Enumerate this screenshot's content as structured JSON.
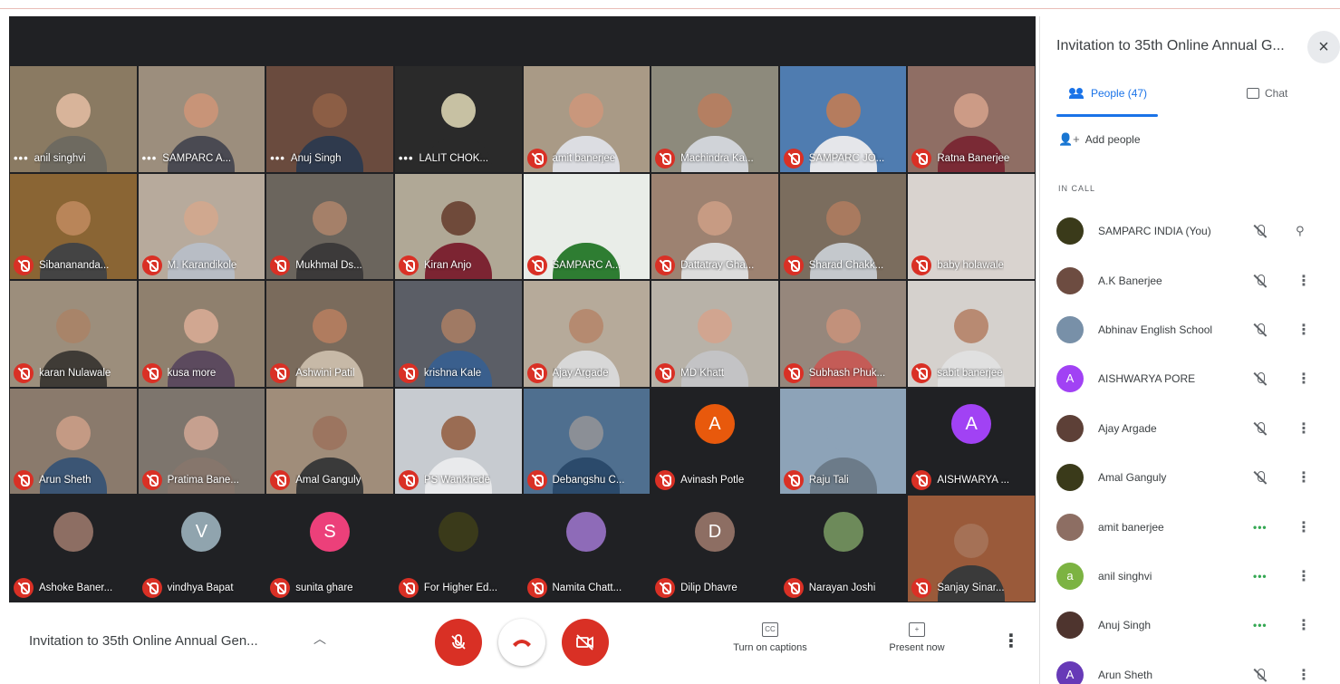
{
  "meeting": {
    "title": "Invitation to 35th Online Annual Gen..."
  },
  "controls": {
    "captions_label": "Turn on captions",
    "present_label": "Present now",
    "expand_icon": "chevron-up-icon",
    "colors": {
      "danger": "#d93025",
      "accent": "#1a73e8"
    }
  },
  "panel": {
    "title": "Invitation to 35th Online Annual G...",
    "tabs": {
      "people": "People (47)",
      "chat": "Chat"
    },
    "add_people": "Add people",
    "section_label": "IN CALL",
    "participants": [
      {
        "name": "SAMPARC INDIA (You)",
        "initial": "",
        "color": "#3a3a1a",
        "status": "muted",
        "action": "pin"
      },
      {
        "name": "A.K Banerjee",
        "initial": "",
        "color": "#6d4c41",
        "status": "muted",
        "action": "more"
      },
      {
        "name": "Abhinav English School",
        "initial": "",
        "color": "#7890a8",
        "status": "muted",
        "action": "more"
      },
      {
        "name": "AISHWARYA PORE",
        "initial": "A",
        "color": "#a142f4",
        "status": "muted",
        "action": "more"
      },
      {
        "name": "Ajay Argade",
        "initial": "",
        "color": "#5d4037",
        "status": "muted",
        "action": "more"
      },
      {
        "name": "Amal Ganguly",
        "initial": "",
        "color": "#3a3a1a",
        "status": "muted",
        "action": "more"
      },
      {
        "name": "amit banerjee",
        "initial": "",
        "color": "#8d6e63",
        "status": "speaking",
        "action": "more"
      },
      {
        "name": "anil singhvi",
        "initial": "a",
        "color": "#7cb342",
        "status": "speaking",
        "action": "more"
      },
      {
        "name": "Anuj Singh",
        "initial": "",
        "color": "#4e342e",
        "status": "speaking",
        "action": "more"
      },
      {
        "name": "Arun Sheth",
        "initial": "A",
        "color": "#673ab7",
        "status": "muted",
        "action": "more"
      }
    ]
  },
  "tiles": [
    {
      "name": "anil singhvi",
      "indicator": "dots",
      "bg": "#8a7a62",
      "skin": "#d8b49a",
      "shirt": "#6e6a60"
    },
    {
      "name": "SAMPARC A...",
      "indicator": "dots",
      "bg": "#9c8e7d",
      "skin": "#c89478",
      "shirt": "#4a4a52"
    },
    {
      "name": "Anuj Singh",
      "indicator": "dots",
      "bg": "#6a4b3e",
      "skin": "#8c5e45",
      "shirt": "#2f3a4d"
    },
    {
      "name": "LALIT CHOK...",
      "indicator": "dots",
      "bg": "#2a2a2a",
      "skin": "#c7c1a3",
      "shirt": "#2a2a2a"
    },
    {
      "name": "amit banerjee",
      "indicator": "muted",
      "bg": "#a99a86",
      "skin": "#c9977c",
      "shirt": "#dcdde2"
    },
    {
      "name": "Machindra Ka...",
      "indicator": "muted",
      "bg": "#8d8a7c",
      "skin": "#b47f62",
      "shirt": "#d0d3d8"
    },
    {
      "name": "SAMPARC JO...",
      "indicator": "muted",
      "bg": "#4f7cb0",
      "skin": "#b57c5e",
      "shirt": "#e5e6ea"
    },
    {
      "name": "Ratna Banerjee",
      "indicator": "muted",
      "bg": "#8f6e64",
      "skin": "#cc9b86",
      "shirt": "#7a2a35"
    },
    {
      "name": "Sibanananda...",
      "indicator": "muted",
      "bg": "#8a6534",
      "skin": "#b98559",
      "shirt": "#444444"
    },
    {
      "name": "M. Karandikole",
      "indicator": "muted",
      "bg": "#b7aa9c",
      "skin": "#d0a88f",
      "shirt": "#b8bdc5"
    },
    {
      "name": "Mukhmal Ds...",
      "indicator": "muted",
      "bg": "#6b655d",
      "skin": "#a58069",
      "shirt": "#3c3a3a"
    },
    {
      "name": "Kiran Anjo",
      "indicator": "muted",
      "bg": "#b0a896",
      "skin": "#6f4a3a",
      "shirt": "#7c2432"
    },
    {
      "name": "SAMPARC A...",
      "indicator": "speaker",
      "bg": "#e9ede8",
      "skin": "#e9ede8",
      "shirt": "#2e7d32"
    },
    {
      "name": "Dattatray Gha...",
      "indicator": "muted",
      "bg": "#9d8271",
      "skin": "#c79b83",
      "shirt": "#dcdcdc"
    },
    {
      "name": "Sharad Chakk...",
      "indicator": "muted",
      "bg": "#7b6d5e",
      "skin": "#a97a5f",
      "shirt": "#c4c8cc"
    },
    {
      "name": "baby holawale",
      "indicator": "muted",
      "bg": "#d9d3cf",
      "skin": "#d9d3cf",
      "shirt": "#d9d3cf"
    },
    {
      "name": "karan Nulawale",
      "indicator": "muted",
      "bg": "#9c8e7c",
      "skin": "#a88469",
      "shirt": "#3f3b36"
    },
    {
      "name": "kusa more",
      "indicator": "muted",
      "bg": "#8f806e",
      "skin": "#d1a791",
      "shirt": "#5c4a5e"
    },
    {
      "name": "Ashwini Patil",
      "indicator": "muted",
      "bg": "#7a6b5c",
      "skin": "#b07c5f",
      "shirt": "#c7b9a7"
    },
    {
      "name": "krishna Kale",
      "indicator": "muted",
      "bg": "#5b5e66",
      "skin": "#a07a64",
      "shirt": "#3a5f8d"
    },
    {
      "name": "Ajay Argade",
      "indicator": "muted",
      "bg": "#b6aa9a",
      "skin": "#b58a70",
      "shirt": "#d8d8d8"
    },
    {
      "name": "MD Khatt",
      "indicator": "muted",
      "bg": "#b8b2a8",
      "skin": "#d1a590",
      "shirt": "#c3c3c5"
    },
    {
      "name": "Subhash Phuk...",
      "indicator": "muted",
      "bg": "#96877c",
      "skin": "#c2917b",
      "shirt": "#c45c57"
    },
    {
      "name": "sabit banerjee",
      "indicator": "muted",
      "bg": "#d5d1cd",
      "skin": "#b88a72",
      "shirt": "#e0e0e0"
    },
    {
      "name": "Arun Sheth",
      "indicator": "muted",
      "bg": "#8a7a6c",
      "skin": "#c49a84",
      "shirt": "#3b5574"
    },
    {
      "name": "Pratima Bane...",
      "indicator": "muted",
      "bg": "#7d756d",
      "skin": "#c6a08f",
      "shirt": "#86766c"
    },
    {
      "name": "Amal Ganguly",
      "indicator": "muted",
      "bg": "#a08d7a",
      "skin": "#9c7560",
      "shirt": "#3a3a3a"
    },
    {
      "name": "PS Wankhede",
      "indicator": "muted",
      "bg": "#c7cbd0",
      "skin": "#9a6c53",
      "shirt": "#e9eaec"
    },
    {
      "name": "Debangshu C...",
      "indicator": "muted",
      "bg": "#4f6f8f",
      "skin": "#8b8f96",
      "shirt": "#2b4a6b"
    },
    {
      "name": "Avinash Potle",
      "indicator": "muted",
      "bg": "#202124",
      "avatar": "A",
      "avatar_color": "#e8590c"
    },
    {
      "name": "Raju Tali",
      "indicator": "muted",
      "bg": "#8da3b8",
      "skin": "#8da3b8",
      "shirt": "#6c7b89"
    },
    {
      "name": "AISHWARYA ...",
      "indicator": "muted",
      "bg": "#202124",
      "avatar": "A",
      "avatar_color": "#a142f4"
    },
    {
      "name": "Ashoke Baner...",
      "indicator": "muted",
      "bg": "#202124",
      "avatar": "",
      "avatar_color": "#8d6e63"
    },
    {
      "name": "vindhya Bapat",
      "indicator": "muted",
      "bg": "#202124",
      "avatar": "V",
      "avatar_color": "#90a4ae"
    },
    {
      "name": "sunita ghare",
      "indicator": "muted",
      "bg": "#202124",
      "avatar": "S",
      "avatar_color": "#ec407a"
    },
    {
      "name": "For Higher Ed...",
      "indicator": "muted",
      "bg": "#202124",
      "avatar": "",
      "avatar_color": "#3a3a1a"
    },
    {
      "name": "Namita Chatt...",
      "indicator": "muted",
      "bg": "#202124",
      "avatar": "",
      "avatar_color": "#8e6bb8"
    },
    {
      "name": "Dilip Dhavre",
      "indicator": "muted",
      "bg": "#202124",
      "avatar": "D",
      "avatar_color": "#8d6e63"
    },
    {
      "name": "Narayan Joshi",
      "indicator": "muted",
      "bg": "#202124",
      "avatar": "",
      "avatar_color": "#6d8a5a"
    },
    {
      "name": "Sanjay Sinar...",
      "indicator": "muted",
      "bg": "#9a5a3a",
      "skin": "#a57156",
      "shirt": "#3a3a3a"
    }
  ]
}
